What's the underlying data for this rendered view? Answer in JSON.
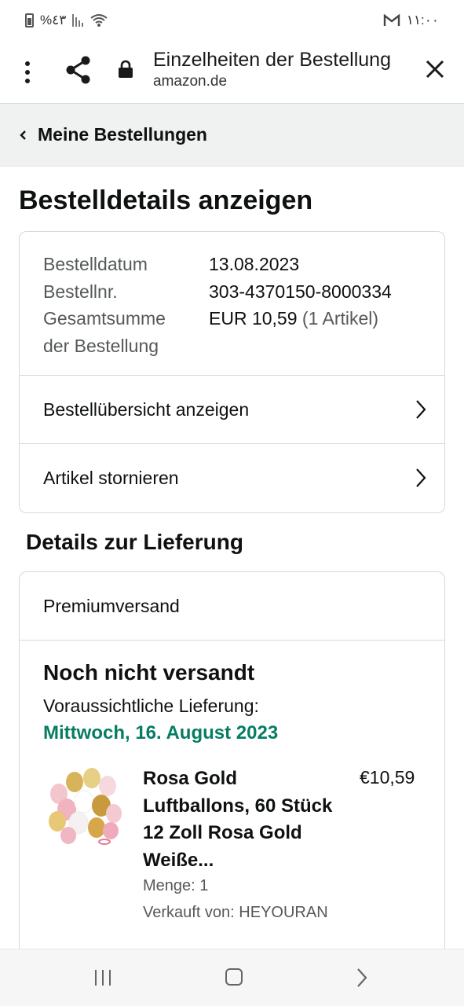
{
  "status_bar": {
    "battery_percent": "%٤٣",
    "clock": "١١:٠٠",
    "mail_letter": "M"
  },
  "browser": {
    "title": "Einzelheiten der Bestellung",
    "url": "amazon.de",
    "icons": [
      "more-vert-icon",
      "share-icon",
      "lock-icon",
      "close-icon"
    ]
  },
  "breadcrumb": {
    "label": "Meine Bestellungen"
  },
  "page": {
    "title": "Bestelldetails anzeigen"
  },
  "order_info": {
    "date_label": "Bestelldatum",
    "date_value": "13.08.2023",
    "number_label": "Bestellnr.",
    "number_value": "303-4370150-8000334",
    "total_label_line1": "Gesamtsumme",
    "total_label_line2": "der Bestellung",
    "total_value": "EUR 10,59",
    "total_items": "(1 Artikel)"
  },
  "order_actions": [
    {
      "label": "Bestellübersicht anzeigen"
    },
    {
      "label": "Artikel stornieren"
    }
  ],
  "delivery": {
    "section_title": "Details zur Lieferung",
    "shipping_method": "Premiumversand",
    "status": "Noch nicht versandt",
    "estimate_label": "Voraussichtliche Lieferung:",
    "estimate_date": "Mittwoch, 16. August 2023",
    "estimate_color": "#067d62"
  },
  "product": {
    "title": "Rosa Gold Luftballons, 60 Stück 12 Zoll Rosa Gold Weiße...",
    "price": "€10,59",
    "quantity": "Menge: 1",
    "seller": "Verkauft von: HEYOURAN"
  },
  "colors": {
    "text": "#0f1111",
    "muted": "#565959",
    "border": "#d5d9d9",
    "breadcrumb_bg": "#f0f2f2"
  }
}
